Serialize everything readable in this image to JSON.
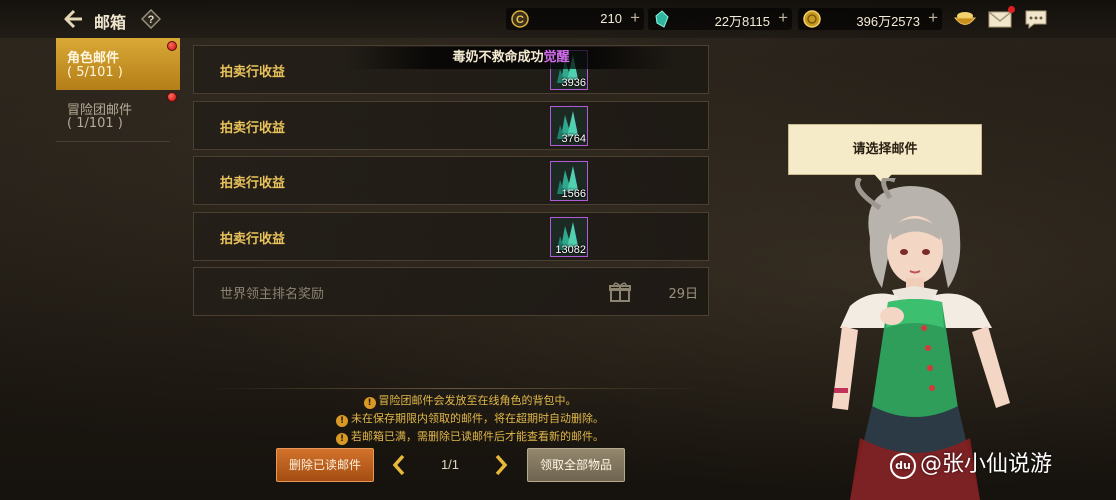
{
  "header": {
    "title": "邮箱",
    "help": "?"
  },
  "currencies": [
    {
      "icon": "gold-coin-c-icon",
      "value": "210"
    },
    {
      "icon": "green-crystal-icon",
      "value": "22万8115"
    },
    {
      "icon": "gold-medal-icon",
      "value": "396万2573"
    }
  ],
  "top_icons": [
    "treasure-bowl-icon",
    "mail-envelope-icon",
    "chat-bubble-icon"
  ],
  "tabs": [
    {
      "label": "角色邮件",
      "count": "( 5/101 )"
    },
    {
      "label": "冒险团邮件",
      "count": "( 1/101 )"
    }
  ],
  "mails": [
    {
      "title": "拍卖行收益",
      "item_count": "3936"
    },
    {
      "title": "拍卖行收益",
      "item_count": "3764"
    },
    {
      "title": "拍卖行收益",
      "item_count": "1566"
    },
    {
      "title": "拍卖行收益",
      "item_count": "13082"
    },
    {
      "title": "世界领主排名奖励",
      "days": "29日"
    }
  ],
  "toast": {
    "prefix": "毒奶不救命成功",
    "highlight": "觉醒"
  },
  "notes": [
    "冒险团邮件会发放至在线角色的背包中。",
    "未在保存期限内领取的邮件，将在超期时自动删除。",
    "若邮箱已满，需删除已读邮件后才能查看新的邮件。"
  ],
  "pagination": {
    "page": "1/1"
  },
  "buttons": {
    "delete_read": "删除已读邮件",
    "claim_all": "领取全部物品"
  },
  "bubble": {
    "text": "请选择邮件"
  },
  "watermark": {
    "logo": "du",
    "text": "@张小仙说游"
  },
  "colors": {
    "accent": "#d9a936",
    "mail_title": "#e8c25a",
    "rarity_epic": "#b25bd6"
  }
}
